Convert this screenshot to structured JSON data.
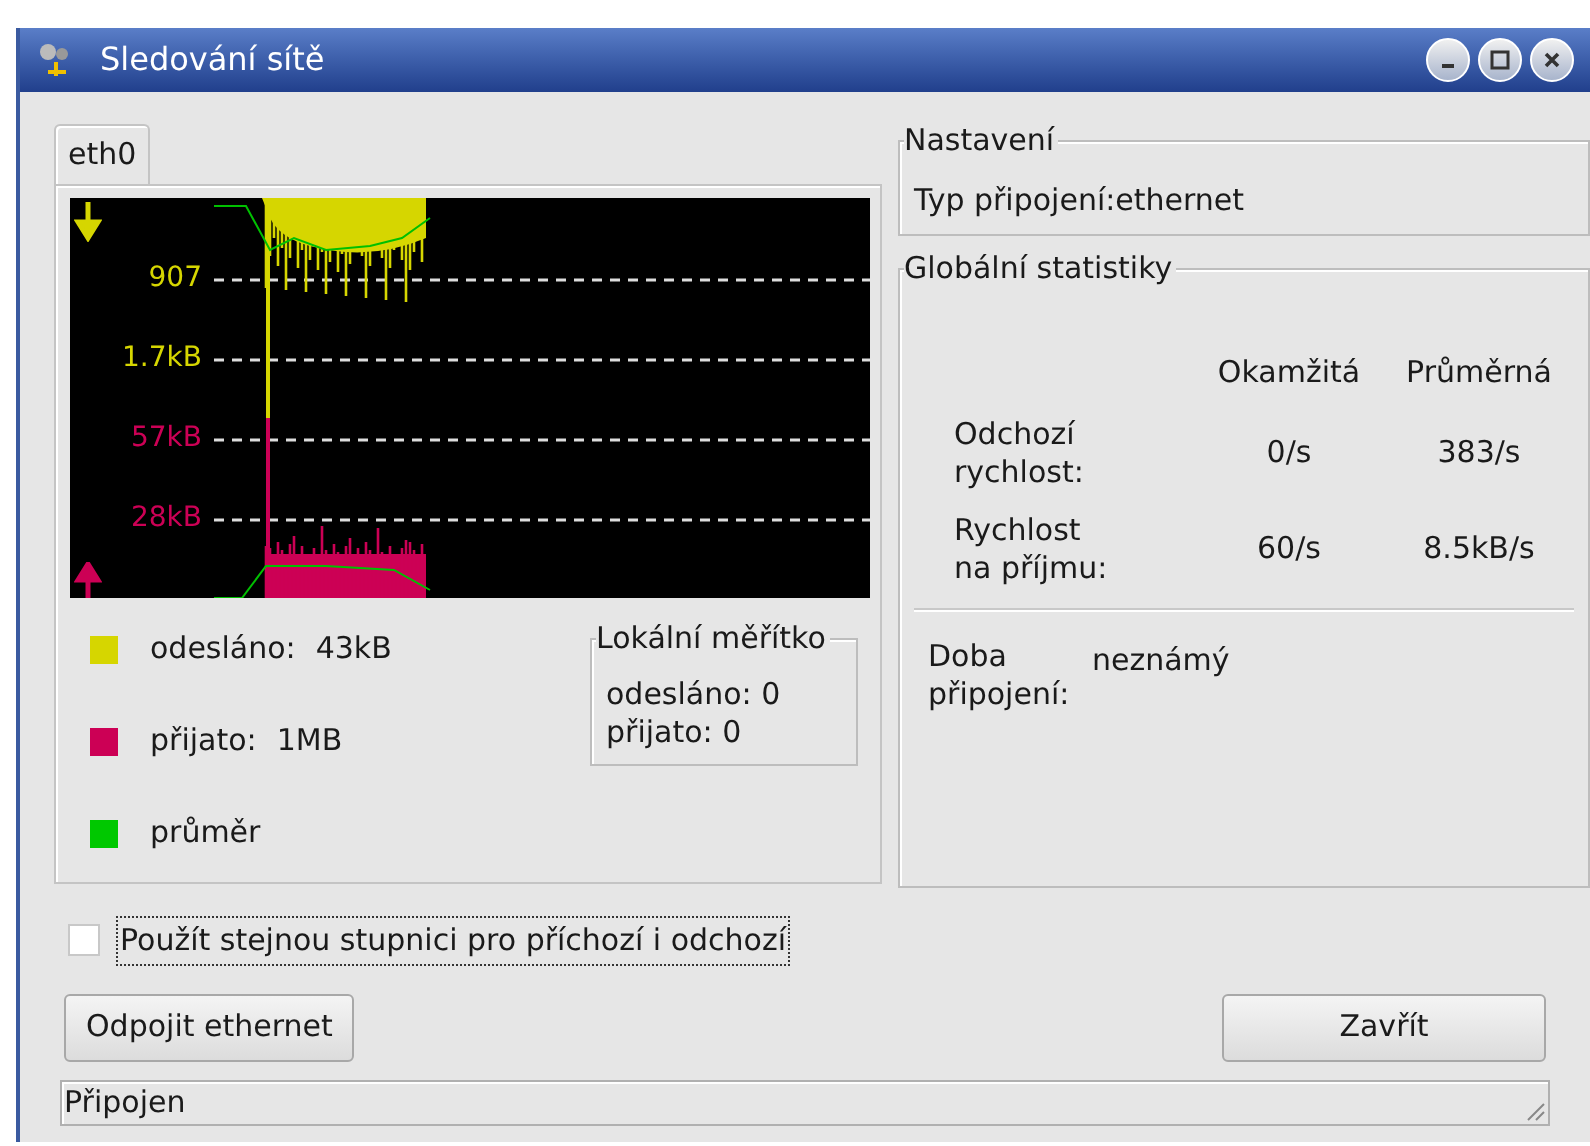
{
  "window": {
    "title": "Sledování sítě"
  },
  "tabs": [
    {
      "label": "eth0",
      "selected": true
    }
  ],
  "graph": {
    "scale_labels": [
      {
        "text": "907",
        "color": "#d6d600"
      },
      {
        "text": "1.7kB",
        "color": "#d6d600"
      },
      {
        "text": "57kB",
        "color": "#cc0055"
      },
      {
        "text": "28kB",
        "color": "#cc0055"
      }
    ]
  },
  "legend": [
    {
      "label": "odesláno:",
      "value": "43kB",
      "color": "#d6d600"
    },
    {
      "label": "přijato:",
      "value": "1MB",
      "color": "#cc0055"
    },
    {
      "label": "průměr",
      "color": "#00c800"
    }
  ],
  "local_scale": {
    "title": "Lokální měřítko",
    "lines": [
      "odesláno: 0",
      "přijato: 0"
    ]
  },
  "settings": {
    "title": "Nastavení",
    "label": "Typ připojení:",
    "value": "ethernet"
  },
  "global_stats": {
    "title": "Globální statistiky",
    "columns": [
      "Okamžitá",
      "Průměrná"
    ],
    "rows": [
      {
        "label": "Odchozí rychlost:",
        "current": "0/s",
        "average": "383/s"
      },
      {
        "label": "Rychlost na příjmu:",
        "current": "60/s",
        "average": "8.5kB/s"
      }
    ],
    "uptime_label": "Doba připojení:",
    "uptime_value": "neznámý"
  },
  "same_scale_checkbox": {
    "label": "Použít stejnou stupnici pro příchozí i odchozí",
    "checked": false
  },
  "buttons": {
    "disconnect": "Odpojit ethernet",
    "close": "Zavřít"
  },
  "status_bar": "Připojen"
}
